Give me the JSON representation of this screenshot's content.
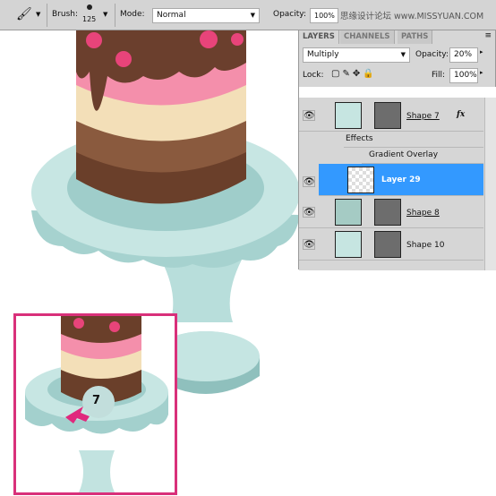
{
  "toolbar": {
    "tool_icon": "brush-icon",
    "brush_label": "Brush:",
    "brush_size": "125",
    "mode_label": "Mode:",
    "mode_value": "Normal",
    "opacity_label": "Opacity:",
    "opacity_value": "100%",
    "watermark": "思缘设计论坛 www.MISSYUAN.COM"
  },
  "layers_panel": {
    "tabs": [
      "LAYERS",
      "CHANNELS",
      "PATHS"
    ],
    "blend_mode": "Multiply",
    "opacity_label": "Opacity:",
    "opacity_value": "20%",
    "lock_label": "Lock:",
    "fill_label": "Fill:",
    "fill_value": "100%",
    "layers": [
      {
        "name": "Shape 7",
        "fx": "fx"
      },
      {
        "name": "Effects"
      },
      {
        "name": "Gradient Overlay"
      },
      {
        "name": "Layer 29",
        "selected": true
      },
      {
        "name": "Shape 8"
      },
      {
        "name": "Shape 10"
      }
    ],
    "selection_color": "#3399ff"
  },
  "inset": {
    "step_number": "7",
    "border_color": "#d9307a"
  }
}
